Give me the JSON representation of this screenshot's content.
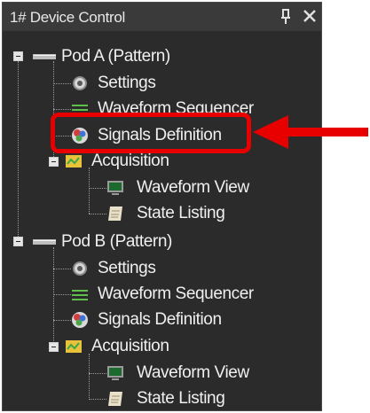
{
  "panel": {
    "title": "1# Device Control"
  },
  "tree": {
    "pod_a": {
      "label": "Pod A (Pattern)",
      "settings": "Settings",
      "waveform_sequencer": "Waveform Sequencer",
      "signals_definition": "Signals Definition",
      "acquisition": "Acquisition",
      "waveform_view": "Waveform View",
      "state_listing": "State Listing"
    },
    "pod_b": {
      "label": "Pod B (Pattern)",
      "settings": "Settings",
      "waveform_sequencer": "Waveform Sequencer",
      "signals_definition": "Signals Definition",
      "acquisition": "Acquisition",
      "waveform_view": "Waveform View",
      "state_listing": "State Listing"
    }
  },
  "colors": {
    "panel_bg": "#2b2b2b",
    "titlebar_bg": "#3a3a3a",
    "text": "#f0f0f0",
    "highlight": "#e80000"
  },
  "icons": {
    "pod": "pod-connector-icon",
    "settings": "gear-icon",
    "sequencer": "sequencer-lines-icon",
    "signals": "signals-globe-icon",
    "acquisition": "acquisition-folder-icon",
    "waveform_view": "monitor-icon",
    "state_listing": "document-icon"
  }
}
